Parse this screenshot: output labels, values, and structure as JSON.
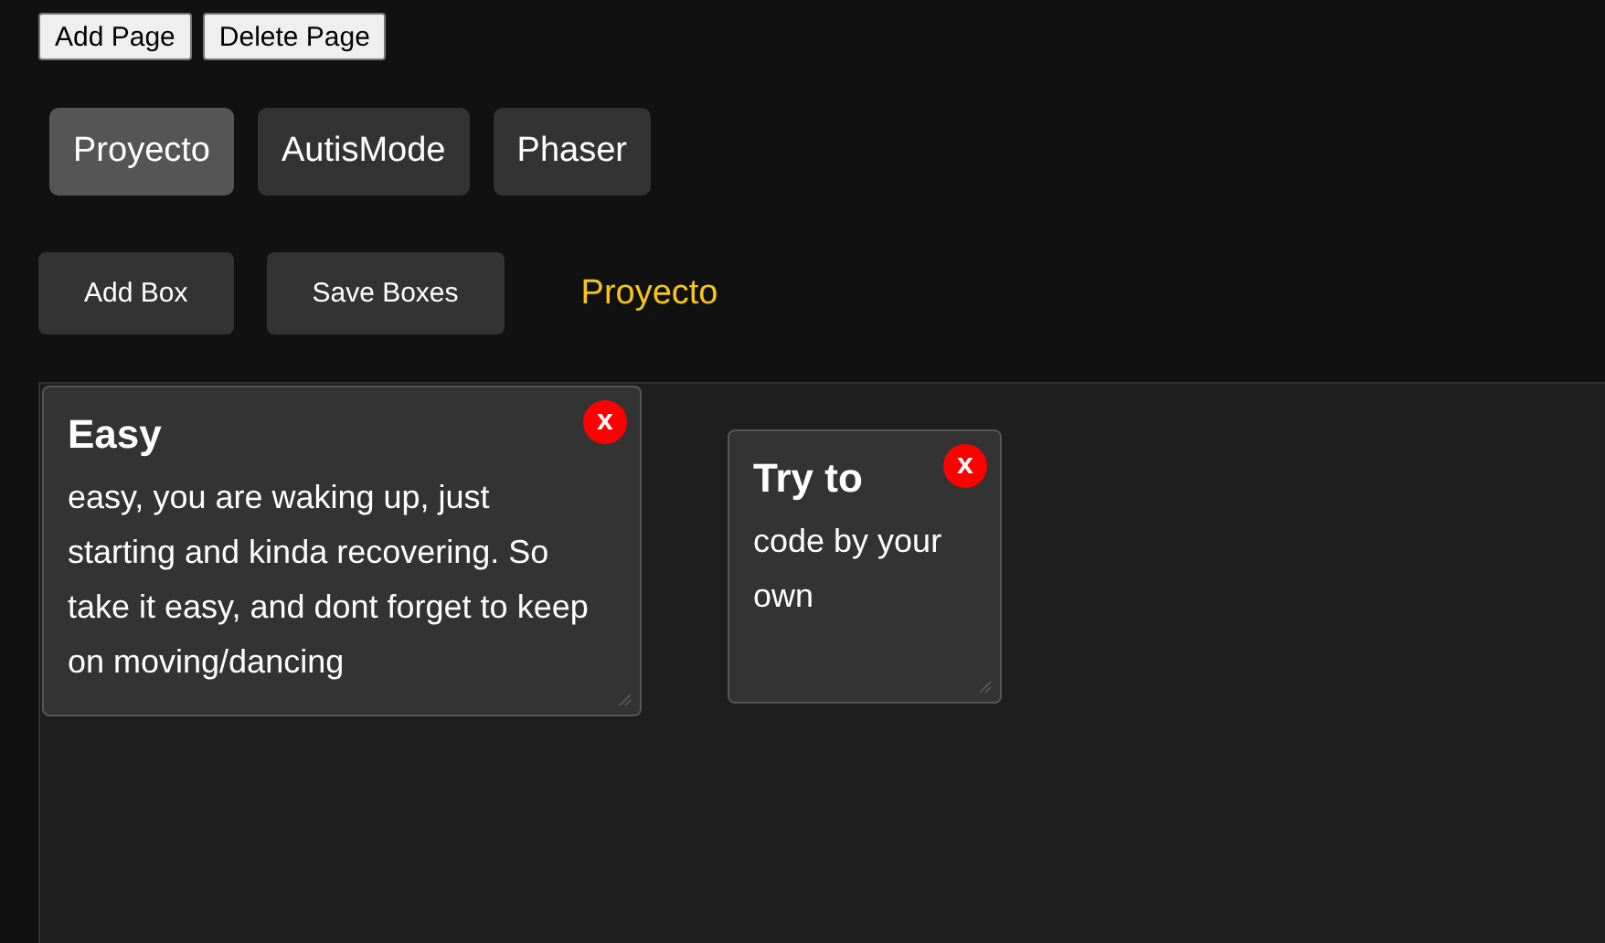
{
  "page_buttons": [
    "Add Page",
    "Delete Page"
  ],
  "tabs": [
    {
      "label": "Proyecto",
      "selected": true
    },
    {
      "label": "AutisMode",
      "selected": false
    },
    {
      "label": "Phaser",
      "selected": false
    }
  ],
  "toolbar": {
    "buttons": [
      "Add Box",
      "Save Boxes"
    ],
    "current_page": "Proyecto"
  },
  "boxes": [
    {
      "title": "Easy",
      "text": "easy, you are waking up, just starting and kinda recovering. So take it easy, and dont forget to keep on moving/dancing",
      "close": "x"
    },
    {
      "title": "Try to",
      "text": "code by your own",
      "close": "x"
    }
  ]
}
